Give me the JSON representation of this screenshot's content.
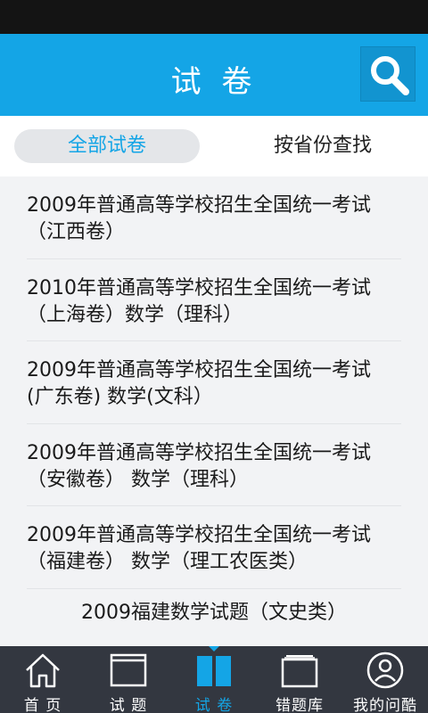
{
  "header": {
    "title": "试 卷",
    "search_icon": "search-icon"
  },
  "filters": {
    "all": "全部试卷",
    "by_province": "按省份查找"
  },
  "papers": [
    {
      "title": "2009年普通高等学校招生全国统一考试（江西卷）"
    },
    {
      "title": "2010年普通高等学校招生全国统一考试（上海卷）数学（理科）"
    },
    {
      "title": "2009年普通高等学校招生全国统一考试(广东卷) 数学(文科）"
    },
    {
      "title": "2009年普通高等学校招生全国统一考试（安徽卷） 数学（理科）"
    },
    {
      "title": "2009年普通高等学校招生全国统一考试（福建卷） 数学（理工农医类）"
    },
    {
      "title": "2009福建数学试题（文史类）"
    }
  ],
  "nav": [
    {
      "label": "首 页",
      "icon": "home-icon"
    },
    {
      "label": "试 题",
      "icon": "questions-icon"
    },
    {
      "label": "试 卷",
      "icon": "papers-icon",
      "active": true
    },
    {
      "label": "错题库",
      "icon": "wrong-questions-icon"
    },
    {
      "label": "我的问酷",
      "icon": "profile-icon"
    }
  ],
  "colors": {
    "accent": "#14a5e6",
    "nav_bg": "#333740",
    "status_bar": "#141414"
  }
}
